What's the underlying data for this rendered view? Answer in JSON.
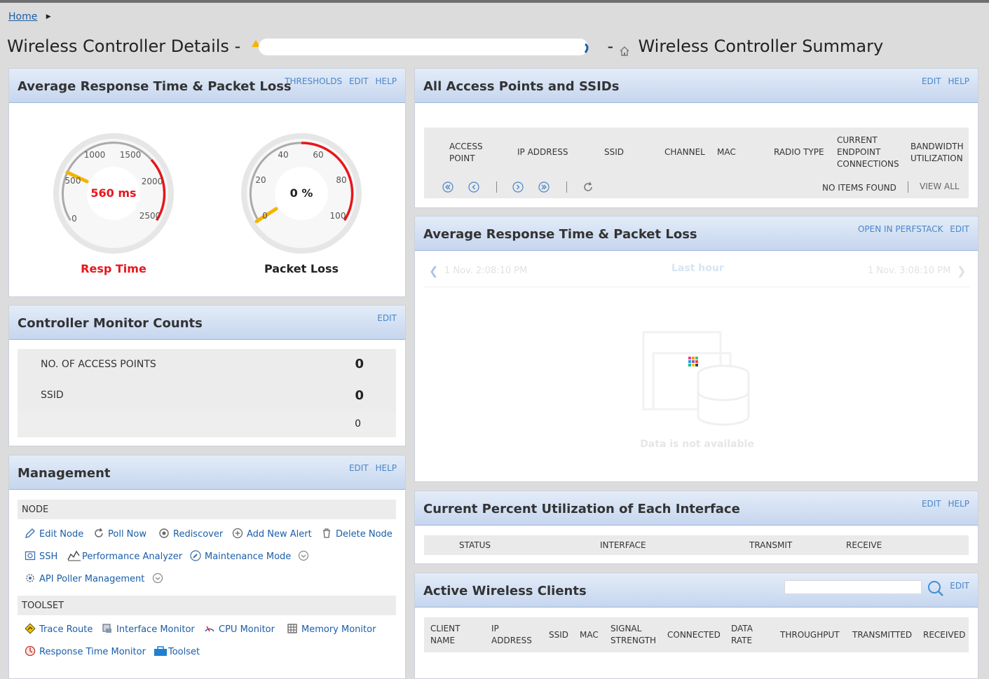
{
  "breadcrumb": {
    "home": "Home"
  },
  "page": {
    "title_prefix": "Wireless Controller Details -",
    "title_sep": "-",
    "title_suffix": "Wireless Controller Summary"
  },
  "panels": {
    "response_gauges": {
      "title": "Average Response Time & Packet Loss",
      "links": [
        "THRESHOLDS",
        "EDIT",
        "HELP"
      ],
      "resp_gauge": {
        "value_text": "560 ms",
        "value": 560,
        "max": 2500,
        "label": "Resp Time",
        "ticks": [
          "0",
          "500",
          "1000",
          "1500",
          "2000",
          "2500"
        ],
        "label_color": "#e8161b"
      },
      "loss_gauge": {
        "value_text": "0 %",
        "value": 0,
        "max": 100,
        "label": "Packet Loss",
        "ticks": [
          "0",
          "20",
          "40",
          "60",
          "80",
          "100"
        ]
      }
    },
    "controller_counts": {
      "title": "Controller Monitor Counts",
      "links": [
        "EDIT"
      ],
      "rows": [
        {
          "label": "NO. OF ACCESS POINTS",
          "value": "0"
        },
        {
          "label": "SSID",
          "value": "0"
        },
        {
          "label": "",
          "value": "0"
        }
      ]
    },
    "management": {
      "title": "Management",
      "links": [
        "EDIT",
        "HELP"
      ],
      "node_section": "NODE",
      "node_links": [
        "Edit Node",
        "Poll Now",
        "Rediscover",
        "Add New Alert",
        "Delete Node",
        "SSH",
        "Performance Analyzer",
        "Maintenance Mode",
        "API Poller Management"
      ],
      "toolset_section": "TOOLSET",
      "toolset_links": [
        "Trace Route",
        "Interface Monitor",
        "CPU Monitor",
        "Memory Monitor",
        "Response Time Monitor",
        "Toolset"
      ]
    },
    "access_points": {
      "title": "All Access Points and SSIDs",
      "links": [
        "EDIT",
        "HELP"
      ],
      "columns": [
        "ACCESS POINT",
        "IP ADDRESS",
        "SSID",
        "CHANNEL",
        "MAC",
        "RADIO TYPE",
        "CURRENT ENDPOINT CONNECTIONS",
        "BANDWIDTH UTILIZATION"
      ],
      "no_items": "NO ITEMS FOUND",
      "view_all": "VIEW ALL"
    },
    "perfstack": {
      "title": "Average Response Time & Packet Loss",
      "links": [
        "OPEN IN PERFSTACK",
        "EDIT"
      ],
      "range_start": "1 Nov. 2:08:10 PM",
      "range_label": "Last hour",
      "range_end": "1 Nov. 3:08:10 PM",
      "empty_text": "Data is not available"
    },
    "utilization": {
      "title": "Current Percent Utilization of Each Interface",
      "links": [
        "EDIT",
        "HELP"
      ],
      "columns": [
        "STATUS",
        "INTERFACE",
        "TRANSMIT",
        "RECEIVE"
      ]
    },
    "wireless_clients": {
      "title": "Active Wireless Clients",
      "links": [
        "EDIT"
      ],
      "search_placeholder": "",
      "columns": [
        "CLIENT NAME",
        "IP ADDRESS",
        "SSID",
        "MAC",
        "SIGNAL STRENGTH",
        "CONNECTED",
        "DATA RATE",
        "THROUGHPUT",
        "TRANSMITTED",
        "RECEIVED"
      ]
    }
  },
  "colors": {
    "link": "#1a5ea8",
    "header_link": "#4a86c8",
    "danger": "#e8161b",
    "needle": "#f5b400"
  }
}
